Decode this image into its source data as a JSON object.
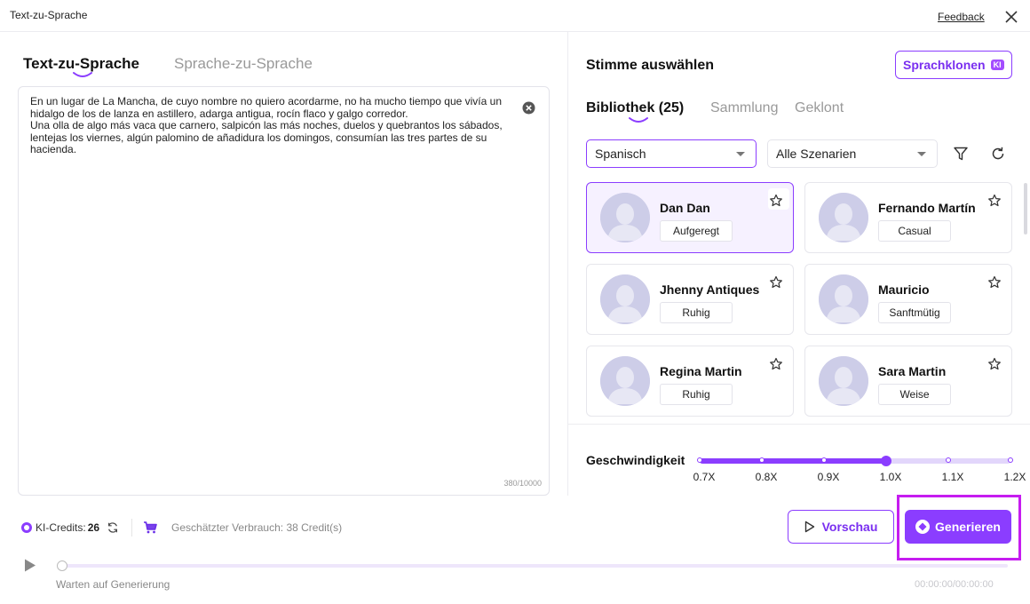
{
  "window": {
    "title": "Text-zu-Sprache",
    "feedback_label": "Feedback"
  },
  "left": {
    "tabs": [
      {
        "label": "Text-zu-Sprache",
        "active": true
      },
      {
        "label": "Sprache-zu-Sprache",
        "active": false
      }
    ],
    "text_content": "En un lugar de La Mancha, de cuyo nombre no quiero acordarme, no ha mucho tiempo que vivía un\nhidalgo de los de lanza en astillero, adarga antigua, rocín flaco y galgo corredor.\nUna olla de algo más vaca que carnero, salpicón las más noches, duelos y quebrantos los sábados,\nlentejas los viernes, algún palomino de añadidura los domingos, consumían las tres partes de su\nhacienda.",
    "char_counter": "380/10000",
    "credits_label": "KI-Credits:",
    "credits_value": "26",
    "estimate": "Geschätzter Verbrauch: 38 Credit(s)"
  },
  "right": {
    "heading": "Stimme auswählen",
    "clone_label": "Sprachklonen",
    "clone_badge": "KI",
    "tabs": [
      {
        "label": "Bibliothek (25)",
        "active": true
      },
      {
        "label": "Sammlung",
        "active": false
      },
      {
        "label": "Geklont",
        "active": false
      }
    ],
    "language_select": "Spanisch",
    "scenario_select": "Alle Szenarien",
    "voices": [
      {
        "name": "Dan Dan",
        "tag": "Aufgeregt",
        "selected": true
      },
      {
        "name": "Fernando Martín",
        "tag": "Casual",
        "selected": false
      },
      {
        "name": "Jhenny Antiques",
        "tag": "Ruhig",
        "selected": false
      },
      {
        "name": "Mauricio",
        "tag": "Sanftmütig",
        "selected": false
      },
      {
        "name": "Regina Martin",
        "tag": "Ruhig",
        "selected": false
      },
      {
        "name": "Sara Martin",
        "tag": "Weise",
        "selected": false
      }
    ],
    "speed_label": "Geschwindigkeit",
    "speed_options": [
      "0.7X",
      "0.8X",
      "0.9X",
      "1.0X",
      "1.1X",
      "1.2X"
    ],
    "speed_value": "1.0X"
  },
  "actions": {
    "preview_label": "Vorschau",
    "generate_label": "Generieren"
  },
  "player": {
    "status": "Warten auf Generierung",
    "time": "00:00:00/00:00:00",
    "progress": 0
  },
  "colors": {
    "accent": "#8b3dff",
    "highlight": "#c61cf0",
    "avatar": "#cfd0ea"
  }
}
